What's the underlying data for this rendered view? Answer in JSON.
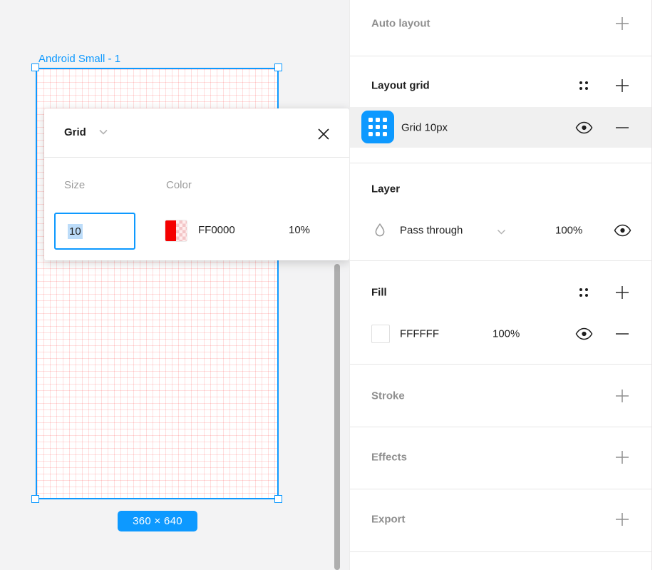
{
  "canvas": {
    "frame_label": "Android Small - 1",
    "size_badge": "360 × 640"
  },
  "popup": {
    "title": "Grid",
    "size_label": "Size",
    "size_value": "10",
    "color_label": "Color",
    "color_hex": "FF0000",
    "color_opacity": "10%"
  },
  "panel": {
    "auto_layout": {
      "title": "Auto layout"
    },
    "layout_grid": {
      "title": "Layout grid",
      "row": {
        "label": "Grid 10px"
      }
    },
    "layer": {
      "title": "Layer",
      "blend_mode": "Pass through",
      "opacity": "100%"
    },
    "fill": {
      "title": "Fill",
      "row": {
        "hex": "FFFFFF",
        "opacity": "100%"
      }
    },
    "stroke": {
      "title": "Stroke"
    },
    "effects": {
      "title": "Effects"
    },
    "export": {
      "title": "Export"
    }
  },
  "colors": {
    "accent_blue": "#0D99FF",
    "grid_red": "#FF0000",
    "fill_white": "#FFFFFF"
  }
}
